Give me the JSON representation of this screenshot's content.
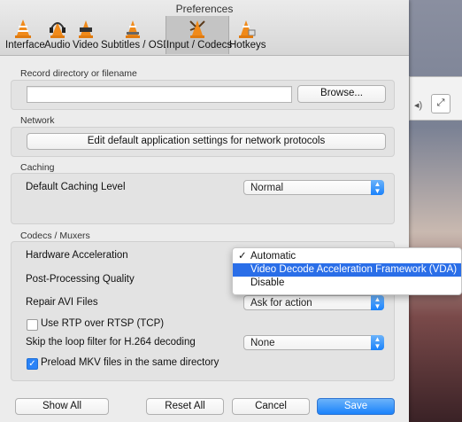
{
  "window": {
    "title": "Preferences"
  },
  "tabs": [
    {
      "label": "Interface",
      "icon": "vlc-cone-icon"
    },
    {
      "label": "Audio",
      "icon": "headphones-cone-icon"
    },
    {
      "label": "Video",
      "icon": "video-cone-icon"
    },
    {
      "label": "Subtitles / OSD",
      "icon": "subtitles-cone-icon"
    },
    {
      "label": "Input / Codecs",
      "icon": "input-codecs-cone-icon",
      "selected": true
    },
    {
      "label": "Hotkeys",
      "icon": "hotkeys-cone-icon"
    }
  ],
  "record": {
    "section_title": "Record directory or filename",
    "path_value": "",
    "browse_label": "Browse..."
  },
  "network": {
    "section_title": "Network",
    "edit_button_label": "Edit default application settings for network protocols"
  },
  "caching": {
    "section_title": "Caching",
    "level_label": "Default Caching Level",
    "level_value": "Normal"
  },
  "codecs": {
    "section_title": "Codecs / Muxers",
    "hw_accel_label": "Hardware Acceleration",
    "hw_accel_options": [
      "Automatic",
      "Video Decode Acceleration Framework (VDA)",
      "Disable"
    ],
    "hw_accel_selected": "Automatic",
    "postproc_label": "Post-Processing Quality",
    "repair_label": "Repair AVI Files",
    "repair_value": "Ask for action",
    "rtp_label": "Use RTP over RTSP (TCP)",
    "rtp_checked": false,
    "loop_filter_label": "Skip the loop filter for H.264 decoding",
    "loop_filter_value": "None",
    "mkv_label": "Preload MKV files in the same directory",
    "mkv_checked": true
  },
  "footer": {
    "show_all": "Show All",
    "reset_all": "Reset All",
    "cancel": "Cancel",
    "save": "Save"
  },
  "colors": {
    "accent": "#1a82fb",
    "menu_highlight": "#2a6ee8"
  }
}
